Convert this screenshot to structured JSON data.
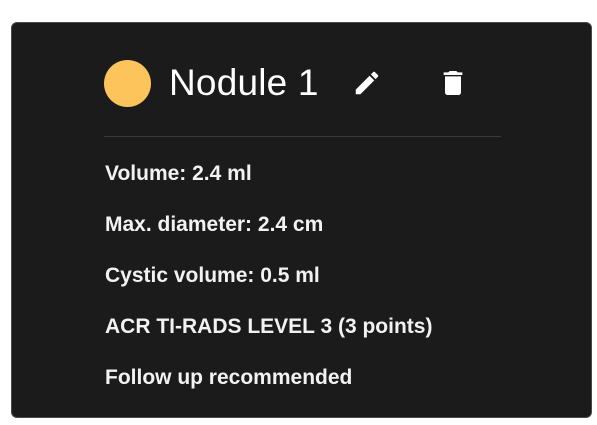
{
  "nodule": {
    "title": "Nodule 1",
    "color": "#fec45c"
  },
  "details": [
    "Volume: 2.4 ml",
    "Max. diameter: 2.4 cm",
    "Cystic volume: 0.5 ml",
    "ACR TI-RADS LEVEL 3 (3 points)",
    "Follow up recommended"
  ],
  "icons": {
    "edit": "pencil-icon",
    "delete": "trash-icon"
  }
}
